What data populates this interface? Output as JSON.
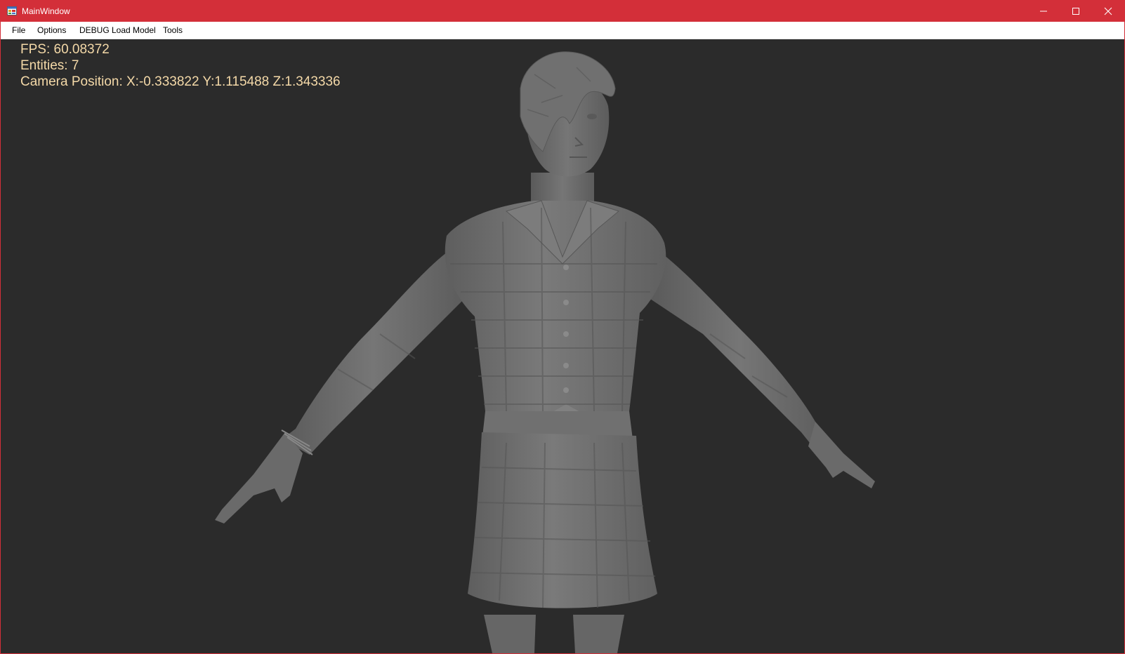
{
  "window": {
    "title": "MainWindow",
    "accent_color": "#d32f39",
    "controls": {
      "minimize": "minimize-icon",
      "maximize": "maximize-icon",
      "close": "close-icon"
    }
  },
  "menubar": {
    "items": [
      "File",
      "Options",
      "DEBUG Load Model",
      "Tools"
    ]
  },
  "viewport": {
    "background": "#2b2b2b",
    "hud": {
      "fps": "FPS: 60.08372",
      "entities": "Entities: 7",
      "camera_position": "Camera Position: X:-0.333822 Y:1.115488 Z:1.343336",
      "text_color": "#f4d9a8"
    },
    "model": {
      "description_icon": "character-model",
      "color": "#6b6b6b"
    }
  }
}
